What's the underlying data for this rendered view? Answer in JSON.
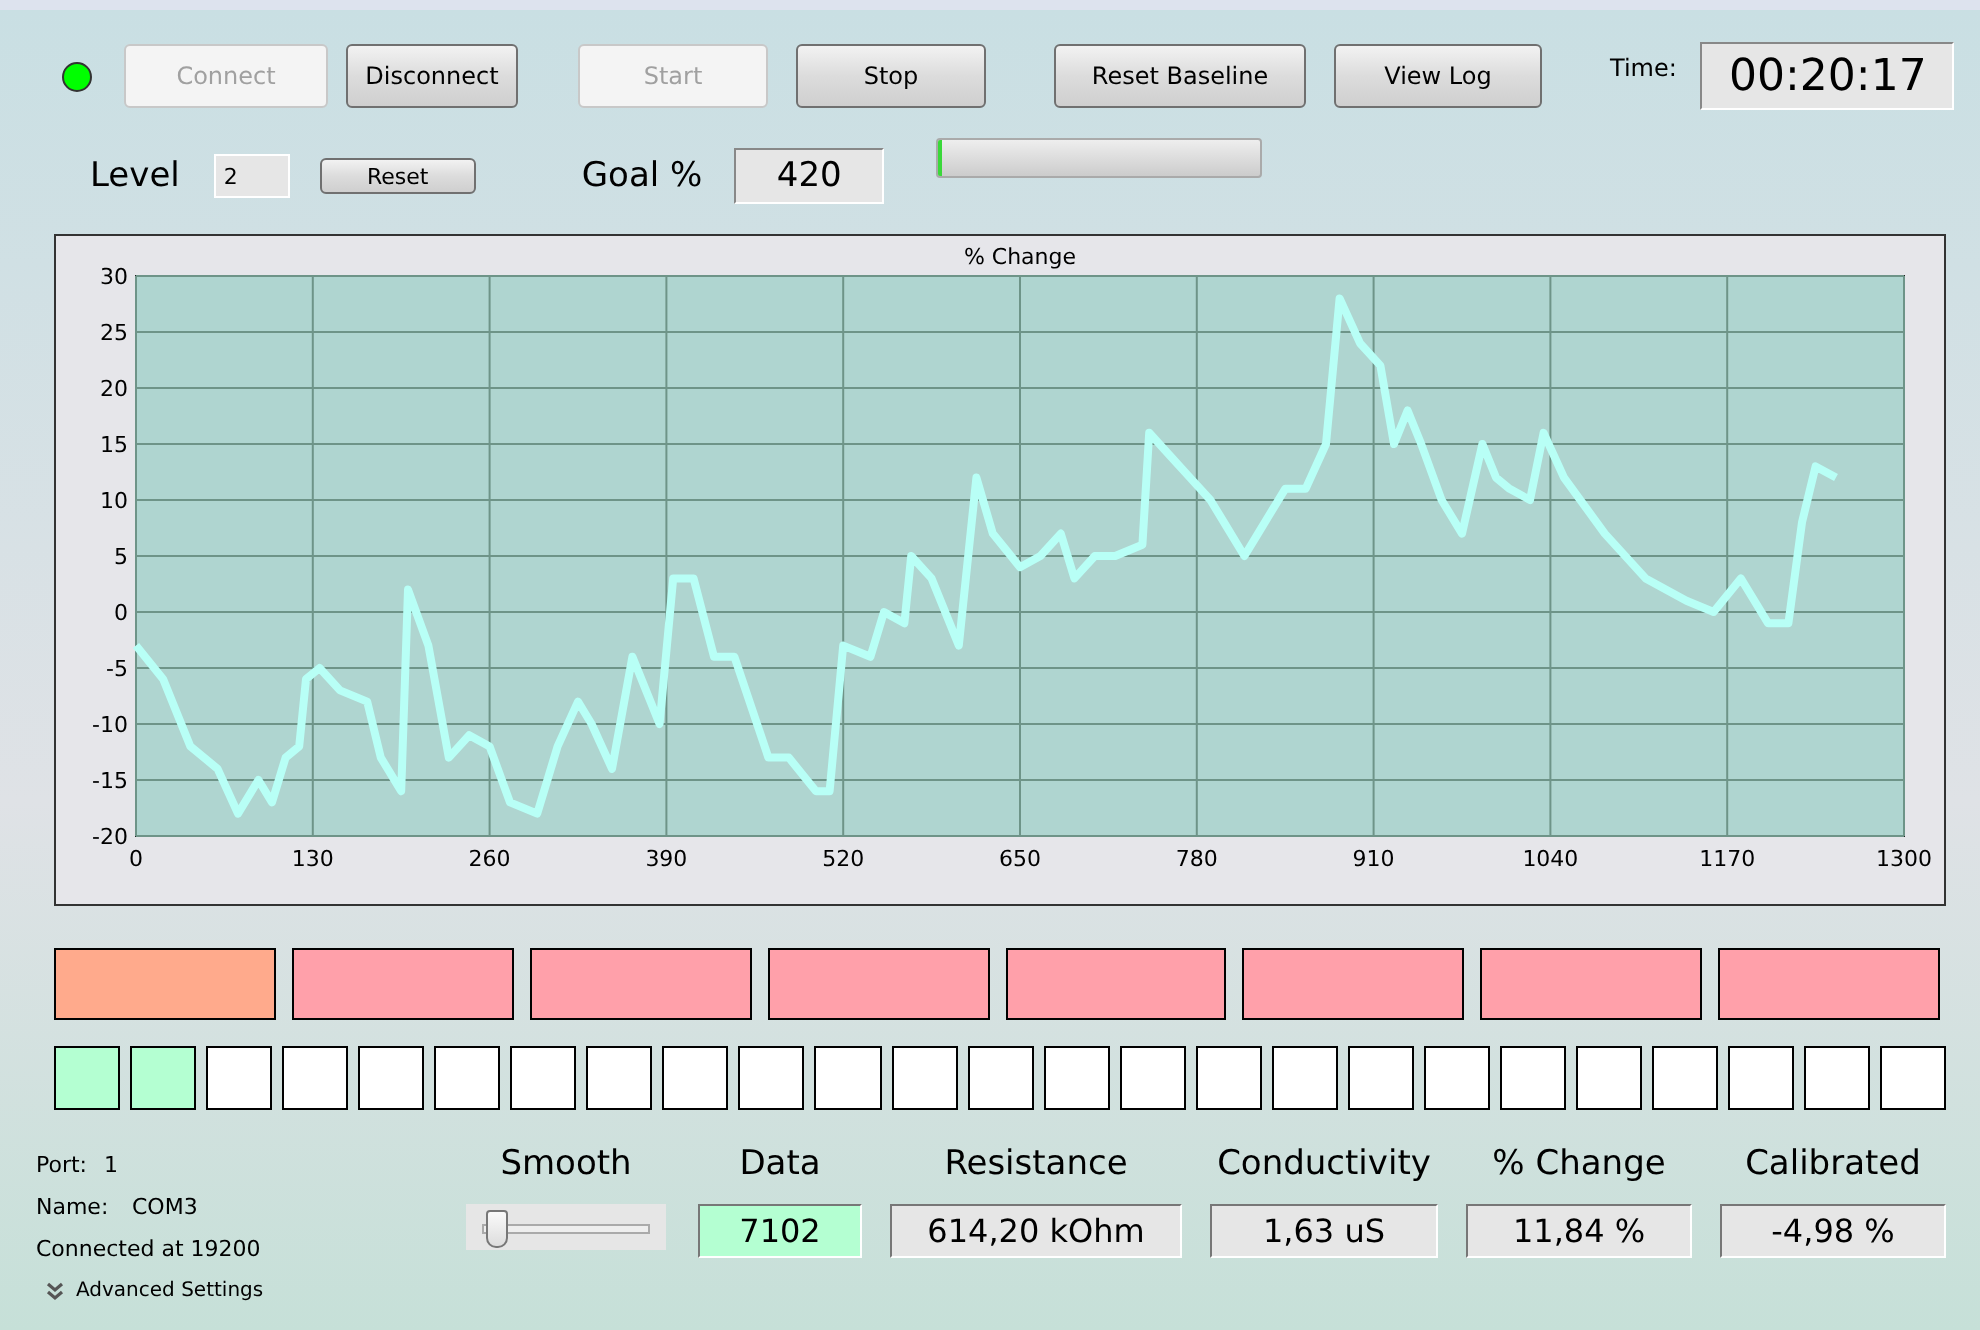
{
  "status_light": {
    "on": true
  },
  "buttons": [
    {
      "label": "Connect",
      "disabled": true
    },
    {
      "label": "Disconnect",
      "disabled": false
    },
    {
      "label": "Start",
      "disabled": true
    },
    {
      "label": "Stop",
      "disabled": false
    },
    {
      "label": "Reset Baseline",
      "disabled": false
    },
    {
      "label": "View Log",
      "disabled": false
    }
  ],
  "time": {
    "label": "Time:",
    "value": "00:20:17"
  },
  "level": {
    "label": "Level",
    "value": "2",
    "reset_button": "Reset"
  },
  "goal": {
    "label": "Goal %",
    "value": "420",
    "progress": {
      "level": 0.01
    }
  },
  "chart": {
    "chart_data": {
      "type": "line",
      "title": "% Change",
      "grid": true,
      "xlim": [
        0,
        1300
      ],
      "ylim": [
        -20,
        30
      ],
      "xticks": [
        0,
        130,
        260,
        390,
        520,
        650,
        780,
        910,
        1040,
        1170,
        1300
      ],
      "yticks": [
        -20,
        -15,
        -10,
        -5,
        0,
        5,
        10,
        15,
        20,
        25,
        30
      ],
      "x": [
        0,
        20,
        40,
        60,
        75,
        90,
        100,
        110,
        120,
        125,
        135,
        150,
        170,
        180,
        195,
        200,
        215,
        230,
        245,
        260,
        275,
        295,
        310,
        325,
        335,
        350,
        365,
        385,
        395,
        410,
        425,
        440,
        465,
        480,
        500,
        510,
        520,
        540,
        550,
        565,
        570,
        585,
        605,
        618,
        630,
        650,
        665,
        680,
        690,
        705,
        720,
        740,
        745,
        760,
        775,
        790,
        800,
        815,
        825,
        845,
        860,
        875,
        885,
        900,
        915,
        925,
        935,
        945,
        960,
        975,
        990,
        1000,
        1010,
        1025,
        1035,
        1050,
        1080,
        1110,
        1140,
        1160,
        1180,
        1200,
        1215,
        1225,
        1235,
        1250
      ],
      "series": [
        {
          "color": "#b8fff6",
          "values": [
            -3,
            -6,
            -12,
            -14,
            -18,
            -15,
            -17,
            -13,
            -12,
            -6,
            -5,
            -7,
            -8,
            -13,
            -16,
            2,
            -3,
            -13,
            -11,
            -12,
            -17,
            -18,
            -12,
            -8,
            -10,
            -14,
            -4,
            -10,
            3,
            3,
            -4,
            -4,
            -13,
            -13,
            -16,
            -16,
            -3,
            -4,
            0,
            -1,
            5,
            3,
            -3,
            12,
            7,
            4,
            5,
            7,
            3,
            5,
            5,
            6,
            16,
            14,
            12,
            10,
            8,
            5,
            7,
            11,
            11,
            15,
            28,
            24,
            22,
            15,
            18,
            15,
            10,
            7,
            15,
            12,
            11,
            10,
            16,
            12,
            7,
            3,
            1,
            0,
            3,
            -1,
            -1,
            8,
            13,
            12
          ]
        }
      ]
    }
  },
  "blocks": [
    {
      "color": "#ffaa8c"
    },
    {
      "color": "#ffa0aa"
    },
    {
      "color": "#ffa0aa"
    },
    {
      "color": "#ffa0aa"
    },
    {
      "color": "#ffa0aa"
    },
    {
      "color": "#ffa0aa"
    },
    {
      "color": "#ffa0aa"
    },
    {
      "color": "#ffa0aa"
    }
  ],
  "squares": [
    {
      "color": "#b4ffd2"
    },
    {
      "color": "#b4ffd2"
    },
    {
      "color": "#ffffff"
    },
    {
      "color": "#ffffff"
    },
    {
      "color": "#ffffff"
    },
    {
      "color": "#ffffff"
    },
    {
      "color": "#ffffff"
    },
    {
      "color": "#ffffff"
    },
    {
      "color": "#ffffff"
    },
    {
      "color": "#ffffff"
    },
    {
      "color": "#ffffff"
    },
    {
      "color": "#ffffff"
    },
    {
      "color": "#ffffff"
    },
    {
      "color": "#ffffff"
    },
    {
      "color": "#ffffff"
    },
    {
      "color": "#ffffff"
    },
    {
      "color": "#ffffff"
    },
    {
      "color": "#ffffff"
    },
    {
      "color": "#ffffff"
    },
    {
      "color": "#ffffff"
    },
    {
      "color": "#ffffff"
    },
    {
      "color": "#ffffff"
    },
    {
      "color": "#ffffff"
    },
    {
      "color": "#ffffff"
    },
    {
      "color": "#ffffff"
    }
  ],
  "port": {
    "port_label": "Port:",
    "port_value": "1",
    "name_label": "Name:",
    "name_value": "COM3",
    "connection": "Connected at 19200",
    "advanced": "Advanced Settings"
  },
  "smooth": {
    "label": "Smooth",
    "level": 0.05
  },
  "readouts": [
    {
      "label": "Data",
      "value": "7102",
      "color": "#b4ffd2"
    },
    {
      "label": "Resistance",
      "value": "614,20 kOhm",
      "color": "#e6e6e6"
    },
    {
      "label": "Conductivity",
      "value": "1,63 uS",
      "color": "#e6e6e6"
    },
    {
      "label": "% Change",
      "value": "11,84 %",
      "color": "#e6e6e6"
    },
    {
      "label": "Calibrated",
      "value": "-4,98 %",
      "color": "#e6e6e6"
    }
  ]
}
